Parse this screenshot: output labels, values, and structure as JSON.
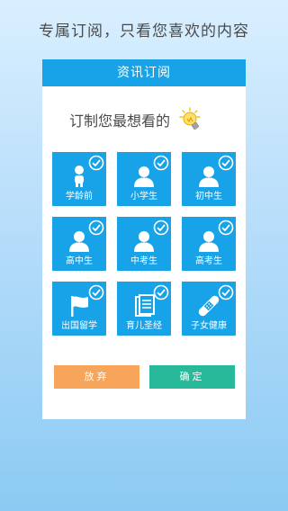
{
  "headline": "专属订阅，只看您喜欢的内容",
  "card": {
    "title": "资讯订阅",
    "prompt": "订制您最想看的"
  },
  "tiles": [
    {
      "label": "学龄前",
      "icon": "baby-icon",
      "selected": true
    },
    {
      "label": "小学生",
      "icon": "user-icon",
      "selected": true
    },
    {
      "label": "初中生",
      "icon": "user-icon",
      "selected": true
    },
    {
      "label": "高中生",
      "icon": "user-icon",
      "selected": true
    },
    {
      "label": "中考生",
      "icon": "user-icon",
      "selected": true
    },
    {
      "label": "高考生",
      "icon": "user-icon",
      "selected": true
    },
    {
      "label": "出国留学",
      "icon": "flag-icon",
      "selected": true
    },
    {
      "label": "育儿圣经",
      "icon": "book-icon",
      "selected": true
    },
    {
      "label": "子女健康",
      "icon": "bandage-icon",
      "selected": true
    }
  ],
  "buttons": {
    "abandon": "放弃",
    "confirm": "确定"
  },
  "colors": {
    "accent": "#18a3e8",
    "abandon": "#f7a55a",
    "confirm": "#27b99a"
  }
}
